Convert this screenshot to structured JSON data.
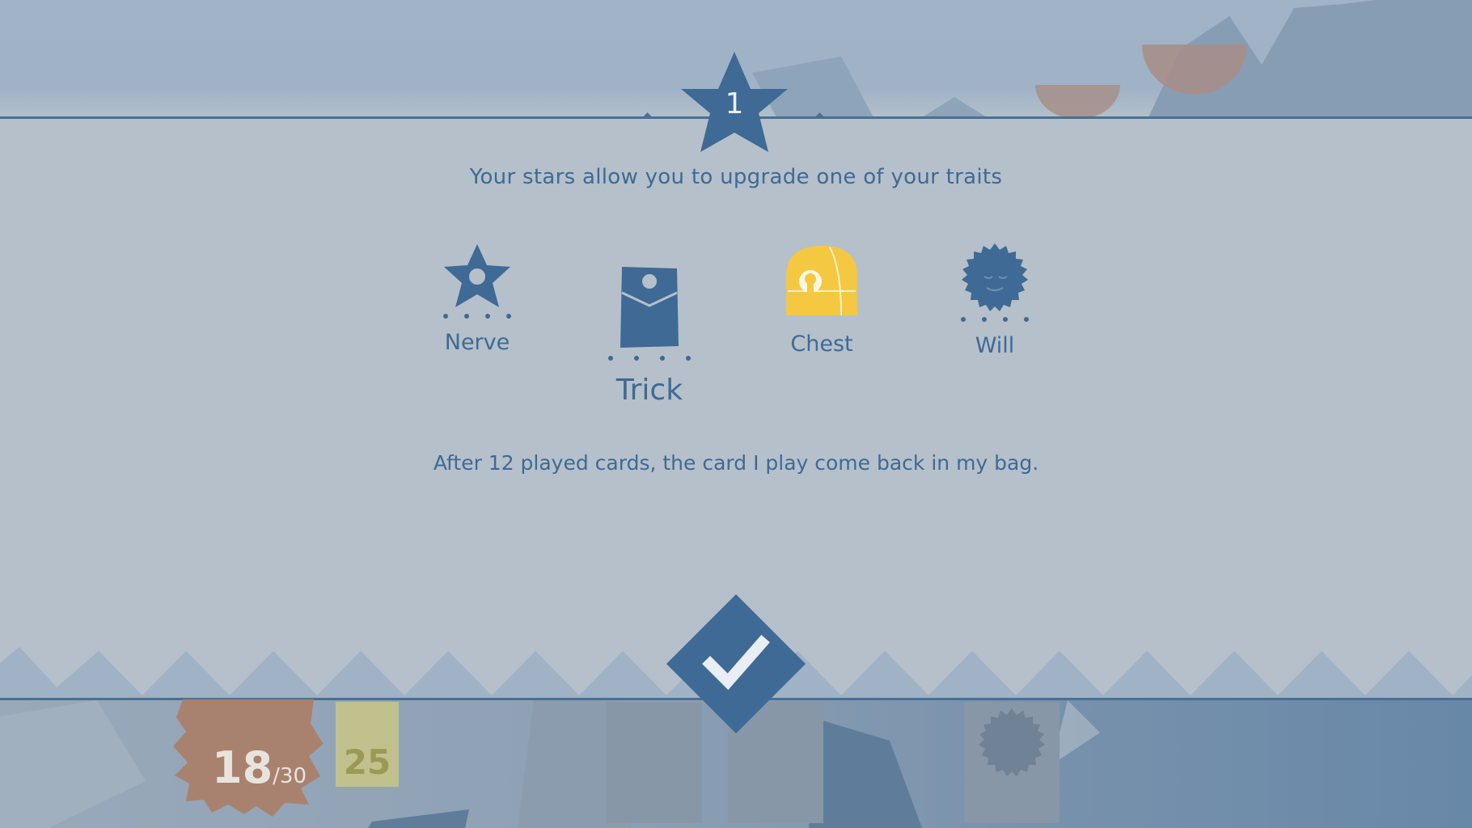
{
  "header": {
    "stars_count": "1",
    "subtitle": "Your stars allow you to upgrade one of your traits"
  },
  "traits": [
    {
      "id": "nerve",
      "label": "Nerve",
      "icon": "star-eye-icon",
      "pips": 4,
      "selected": false
    },
    {
      "id": "trick",
      "label": "Trick",
      "icon": "card-eye-icon",
      "pips": 4,
      "selected": true
    },
    {
      "id": "chest",
      "label": "Chest",
      "icon": "chest-lock-icon",
      "pips": 0,
      "selected": false,
      "color": "#f5c842"
    },
    {
      "id": "will",
      "label": "Will",
      "icon": "sun-face-icon",
      "pips": 4,
      "selected": false
    }
  ],
  "description": "After 12 played cards, the card I play come back in my bag.",
  "confirm": {
    "icon": "checkmark-icon"
  },
  "status": {
    "health_current": "18",
    "health_max": "/30",
    "gold": "25"
  },
  "colors": {
    "accent": "#3e6a95",
    "panel": "#b5c0ca",
    "chest": "#f5c842",
    "health": "#a9826f"
  }
}
